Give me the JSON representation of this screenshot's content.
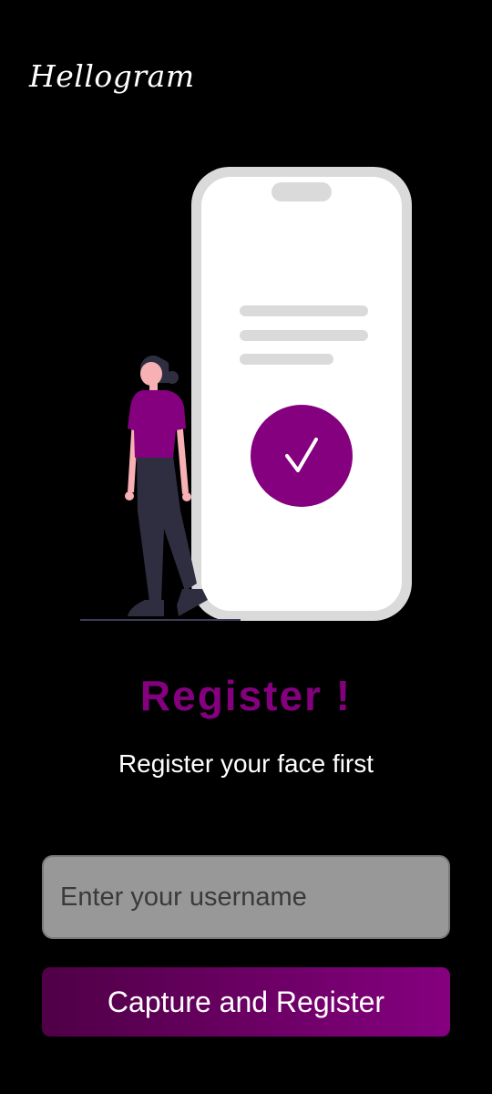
{
  "app": {
    "logo_text": "Hellogram"
  },
  "register": {
    "title": "Register !",
    "subtitle": "Register your face first"
  },
  "form": {
    "username_placeholder": "Enter your username",
    "username_value": "",
    "submit_label": "Capture and Register"
  },
  "colors": {
    "background": "#000000",
    "accent": "#85007f",
    "accent_dark": "#4f0046",
    "input_bg": "#989898",
    "phone_frame": "#dadadb",
    "text_light": "#ffffff"
  },
  "icons": {
    "check": "check-icon",
    "phone": "phone-illustration",
    "person": "woman-illustration"
  }
}
